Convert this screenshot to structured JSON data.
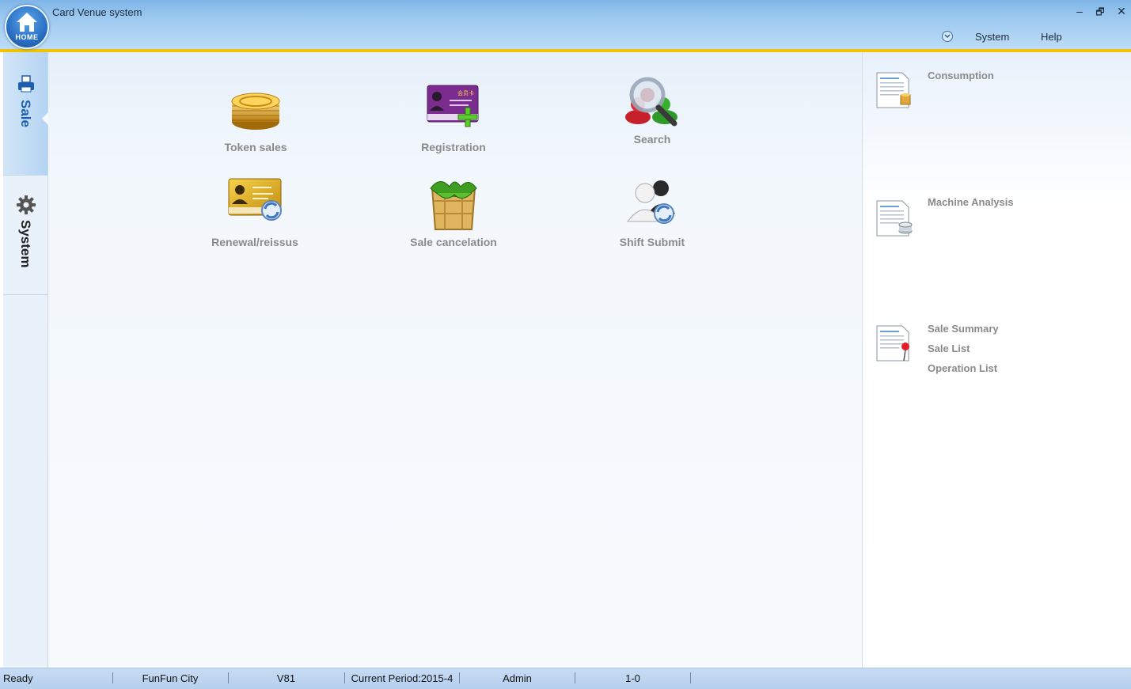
{
  "window": {
    "title": "Card Venue system",
    "home_label": "HOME",
    "controls": {
      "minimize": "–",
      "restore": "🗗",
      "close": "✕"
    }
  },
  "menu": {
    "items": [
      "System",
      "Help"
    ]
  },
  "sidebar": {
    "tabs": [
      {
        "label": "Sale",
        "icon": "printer-icon",
        "active": true
      },
      {
        "label": "System",
        "icon": "gear-icon",
        "active": false
      }
    ]
  },
  "main": {
    "tiles": [
      {
        "label": "Token sales",
        "icon": "coins-icon"
      },
      {
        "label": "Registration",
        "icon": "member-card-add-icon"
      },
      {
        "label": "Search",
        "icon": "magnifier-user-icon"
      },
      {
        "label": "Renewal/reissus",
        "icon": "gold-card-renew-icon"
      },
      {
        "label": "Sale cancelation",
        "icon": "crate-icon"
      },
      {
        "label": "Shift Submit",
        "icon": "users-sync-icon"
      }
    ],
    "card_text": "会员卡"
  },
  "reports": {
    "groups": [
      {
        "icon": "report-coins-icon",
        "links": [
          "Consumption"
        ]
      },
      {
        "icon": "report-disk-icon",
        "links": [
          "Machine Analysis"
        ]
      },
      {
        "icon": "report-pin-icon",
        "links": [
          "Sale Summary",
          "Sale List",
          "Operation List"
        ]
      }
    ]
  },
  "status": {
    "state": "Ready",
    "venue": "FunFun City",
    "version": "V81",
    "period": "Current Period:2015-4",
    "user": "Admin",
    "code": "1-0"
  },
  "colors": {
    "accent": "#f2c200",
    "titlebar": "#9fcaf0",
    "active_tab_text": "#1d5fae",
    "tile_label": "#8a8a8a"
  }
}
